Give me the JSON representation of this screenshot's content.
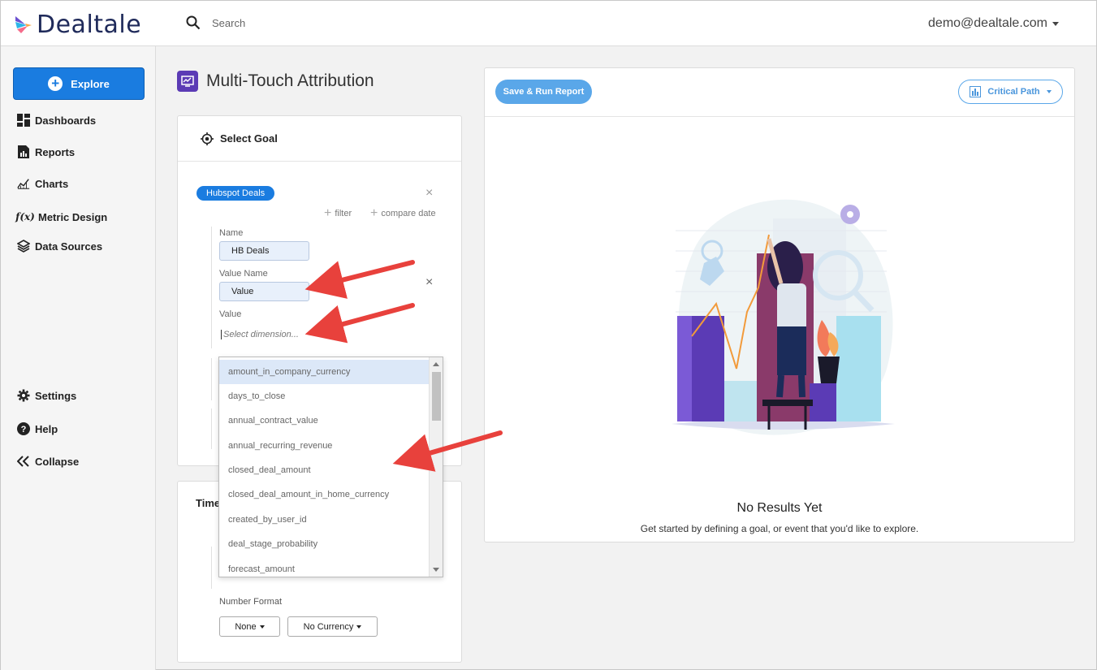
{
  "brand": {
    "name": "Dealtale"
  },
  "search": {
    "placeholder": "Search"
  },
  "user": {
    "email": "demo@dealtale.com"
  },
  "sidebar": {
    "explore_label": "Explore",
    "items": [
      {
        "label": "Dashboards",
        "icon": "dashboard-icon"
      },
      {
        "label": "Reports",
        "icon": "report-icon"
      },
      {
        "label": "Charts",
        "icon": "chart-icon"
      },
      {
        "label": "Metric Design",
        "icon": "function-icon"
      },
      {
        "label": "Data Sources",
        "icon": "layers-icon"
      }
    ],
    "bottom": [
      {
        "label": "Settings",
        "icon": "gear-icon"
      },
      {
        "label": "Help",
        "icon": "help-icon"
      },
      {
        "label": "Collapse",
        "icon": "collapse-icon"
      }
    ]
  },
  "page": {
    "title": "Multi-Touch Attribution"
  },
  "goal": {
    "header": "Select Goal",
    "source_pill": "Hubspot Deals",
    "filter_label": "filter",
    "compare_label": "compare date",
    "name_label": "Name",
    "name_value": "HB Deals",
    "value_name_label": "Value Name",
    "value_name_value": "Value",
    "value_label": "Value",
    "value_placeholder": "Select dimension..."
  },
  "dimension_options": [
    "amount_in_company_currency",
    "days_to_close",
    "annual_contract_value",
    "annual_recurring_revenue",
    "closed_deal_amount",
    "closed_deal_amount_in_home_currency",
    "created_by_user_id",
    "deal_stage_probability",
    "forecast_amount"
  ],
  "time": {
    "header": "Time",
    "number_format_label": "Number Format",
    "format_value": "None",
    "currency_value": "No Currency"
  },
  "results": {
    "save_run_label": "Save & Run Report",
    "view_label": "Critical Path",
    "empty_title": "No Results Yet",
    "empty_subtitle": "Get started by defining a goal, or event that you'd like to explore."
  },
  "colors": {
    "primary": "#1a7ce0",
    "light_primary": "#5aa7e9",
    "brand_purple": "#5b3bb5",
    "annotation_arrow": "#e8413c"
  }
}
